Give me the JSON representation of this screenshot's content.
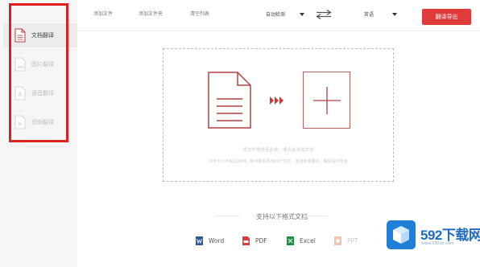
{
  "sidebar": {
    "items": [
      {
        "label": "文档翻译",
        "icon": "document-icon",
        "active": true
      },
      {
        "label": "图片翻译",
        "icon": "image-icon",
        "active": false
      },
      {
        "label": "语音翻译",
        "icon": "voice-icon",
        "active": false
      },
      {
        "label": "视频翻译",
        "icon": "video-icon",
        "active": false
      }
    ]
  },
  "toolbar": {
    "add_file": "添加文件",
    "add_folder": "添加文件夹",
    "clear_list": "清空列表",
    "source_lang": "自动检测",
    "target_lang": "英语",
    "swap_icon": "swap-arrows-icon",
    "export_label": "翻译导出"
  },
  "dropzone": {
    "hint_line1": "将文件拖拽至此处，或点击添加文件",
    "hint_line2": "文件大小不超过10M，单次最多添加20个文件，支持批量翻译，翻译后可导出"
  },
  "formats": {
    "title": "支持以下格式文档",
    "items": [
      {
        "label": "Word",
        "icon": "word-icon",
        "color": "#2b579a"
      },
      {
        "label": "PDF",
        "icon": "pdf-icon",
        "color": "#e03a3a"
      },
      {
        "label": "Excel",
        "icon": "excel-icon",
        "color": "#1e8e3e"
      },
      {
        "label": "PPT",
        "icon": "ppt-icon",
        "color": "#e8774d"
      }
    ]
  },
  "watermark": {
    "title": "592下载网",
    "url": "www.592xz.com"
  },
  "colors": {
    "accent": "#e03a3a",
    "highlight_border": "#e02020",
    "watermark_blue": "#1e7fd8"
  }
}
